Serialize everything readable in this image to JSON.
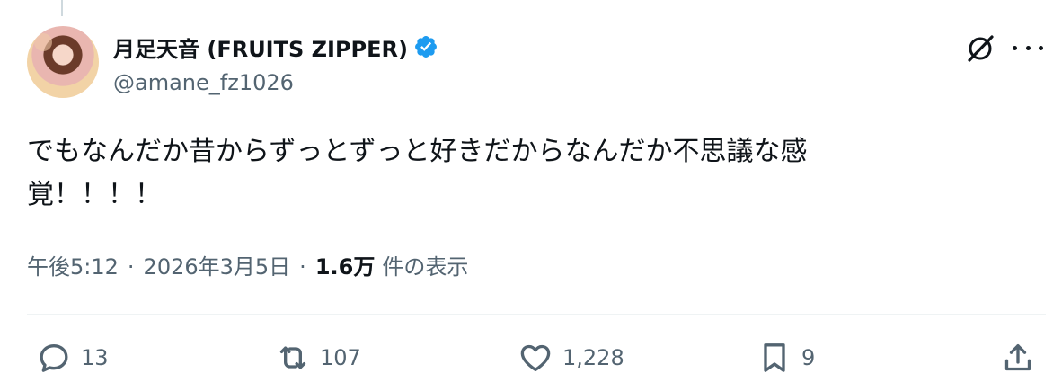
{
  "author": {
    "display_name": "月足天音 (FRUITS ZIPPER)",
    "handle": "@amane_fz1026",
    "verified": true,
    "verified_color": "#1d9bf0"
  },
  "tweet": {
    "text": "でもなんだか昔からずっとずっと好きだからなんだか不思議な感\n覚！！！！"
  },
  "meta": {
    "time": "午後5:12",
    "separator": "·",
    "date": "2026年3月5日",
    "views_count": "1.6万",
    "views_label": "件の表示"
  },
  "actions": {
    "replies": "13",
    "retweets": "107",
    "likes": "1,228",
    "bookmarks": "9"
  },
  "icons": {
    "grok": "grok-icon",
    "more": "more-icon",
    "reply": "reply-icon",
    "retweet": "retweet-icon",
    "like": "heart-icon",
    "bookmark": "bookmark-icon",
    "share": "share-icon"
  }
}
